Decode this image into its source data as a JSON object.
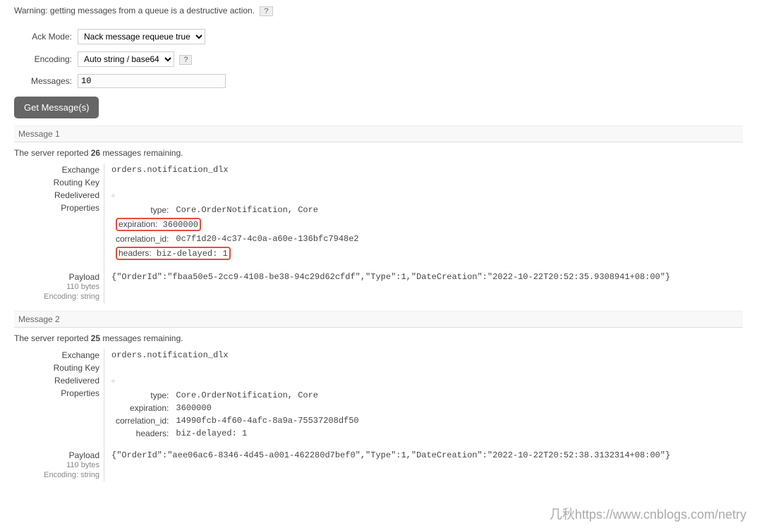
{
  "warning": "Warning: getting messages from a queue is a destructive action.",
  "form": {
    "ack_mode_label": "Ack Mode:",
    "ack_mode_value": "Nack message requeue true",
    "encoding_label": "Encoding:",
    "encoding_value": "Auto string / base64",
    "messages_label": "Messages:",
    "messages_value": "10",
    "get_button": "Get Message(s)"
  },
  "messages": [
    {
      "header": "Message 1",
      "remaining_prefix": "The server reported ",
      "remaining_count": "26",
      "remaining_suffix": " messages remaining.",
      "exchange_label": "Exchange",
      "exchange": "orders.notification_dlx",
      "routing_key_label": "Routing Key",
      "routing_key": "",
      "redelivered_label": "Redelivered",
      "redelivered": "○",
      "properties_label": "Properties",
      "type_label": "type:",
      "type": "Core.OrderNotification, Core",
      "expiration_label": "expiration:",
      "expiration": "3600000",
      "correlation_label": "correlation_id:",
      "correlation": "0c7f1d20-4c37-4c0a-a60e-136bfc7948e2",
      "headers_label": "headers:",
      "headers_key": "biz-delayed:",
      "headers_val": "1",
      "payload_label": "Payload",
      "size": "110 bytes",
      "encoding": "Encoding: string",
      "payload": "{\"OrderId\":\"fbaa50e5-2cc9-4108-be38-94c29d62cfdf\",\"Type\":1,\"DateCreation\":\"2022-10-22T20:52:35.9308941+08:00\"}",
      "highlight": true
    },
    {
      "header": "Message 2",
      "remaining_prefix": "The server reported ",
      "remaining_count": "25",
      "remaining_suffix": " messages remaining.",
      "exchange_label": "Exchange",
      "exchange": "orders.notification_dlx",
      "routing_key_label": "Routing Key",
      "routing_key": "",
      "redelivered_label": "Redelivered",
      "redelivered": "○",
      "properties_label": "Properties",
      "type_label": "type:",
      "type": "Core.OrderNotification, Core",
      "expiration_label": "expiration:",
      "expiration": "3600000",
      "correlation_label": "correlation_id:",
      "correlation": "14990fcb-4f60-4afc-8a9a-75537208df50",
      "headers_label": "headers:",
      "headers_key": "biz-delayed:",
      "headers_val": "1",
      "payload_label": "Payload",
      "size": "110 bytes",
      "encoding": "Encoding: string",
      "payload": "{\"OrderId\":\"aee06ac6-8346-4d45-a001-462280d7bef0\",\"Type\":1,\"DateCreation\":\"2022-10-22T20:52:38.3132314+08:00\"}",
      "highlight": false
    }
  ],
  "watermark": "几秋https://www.cnblogs.com/netry"
}
